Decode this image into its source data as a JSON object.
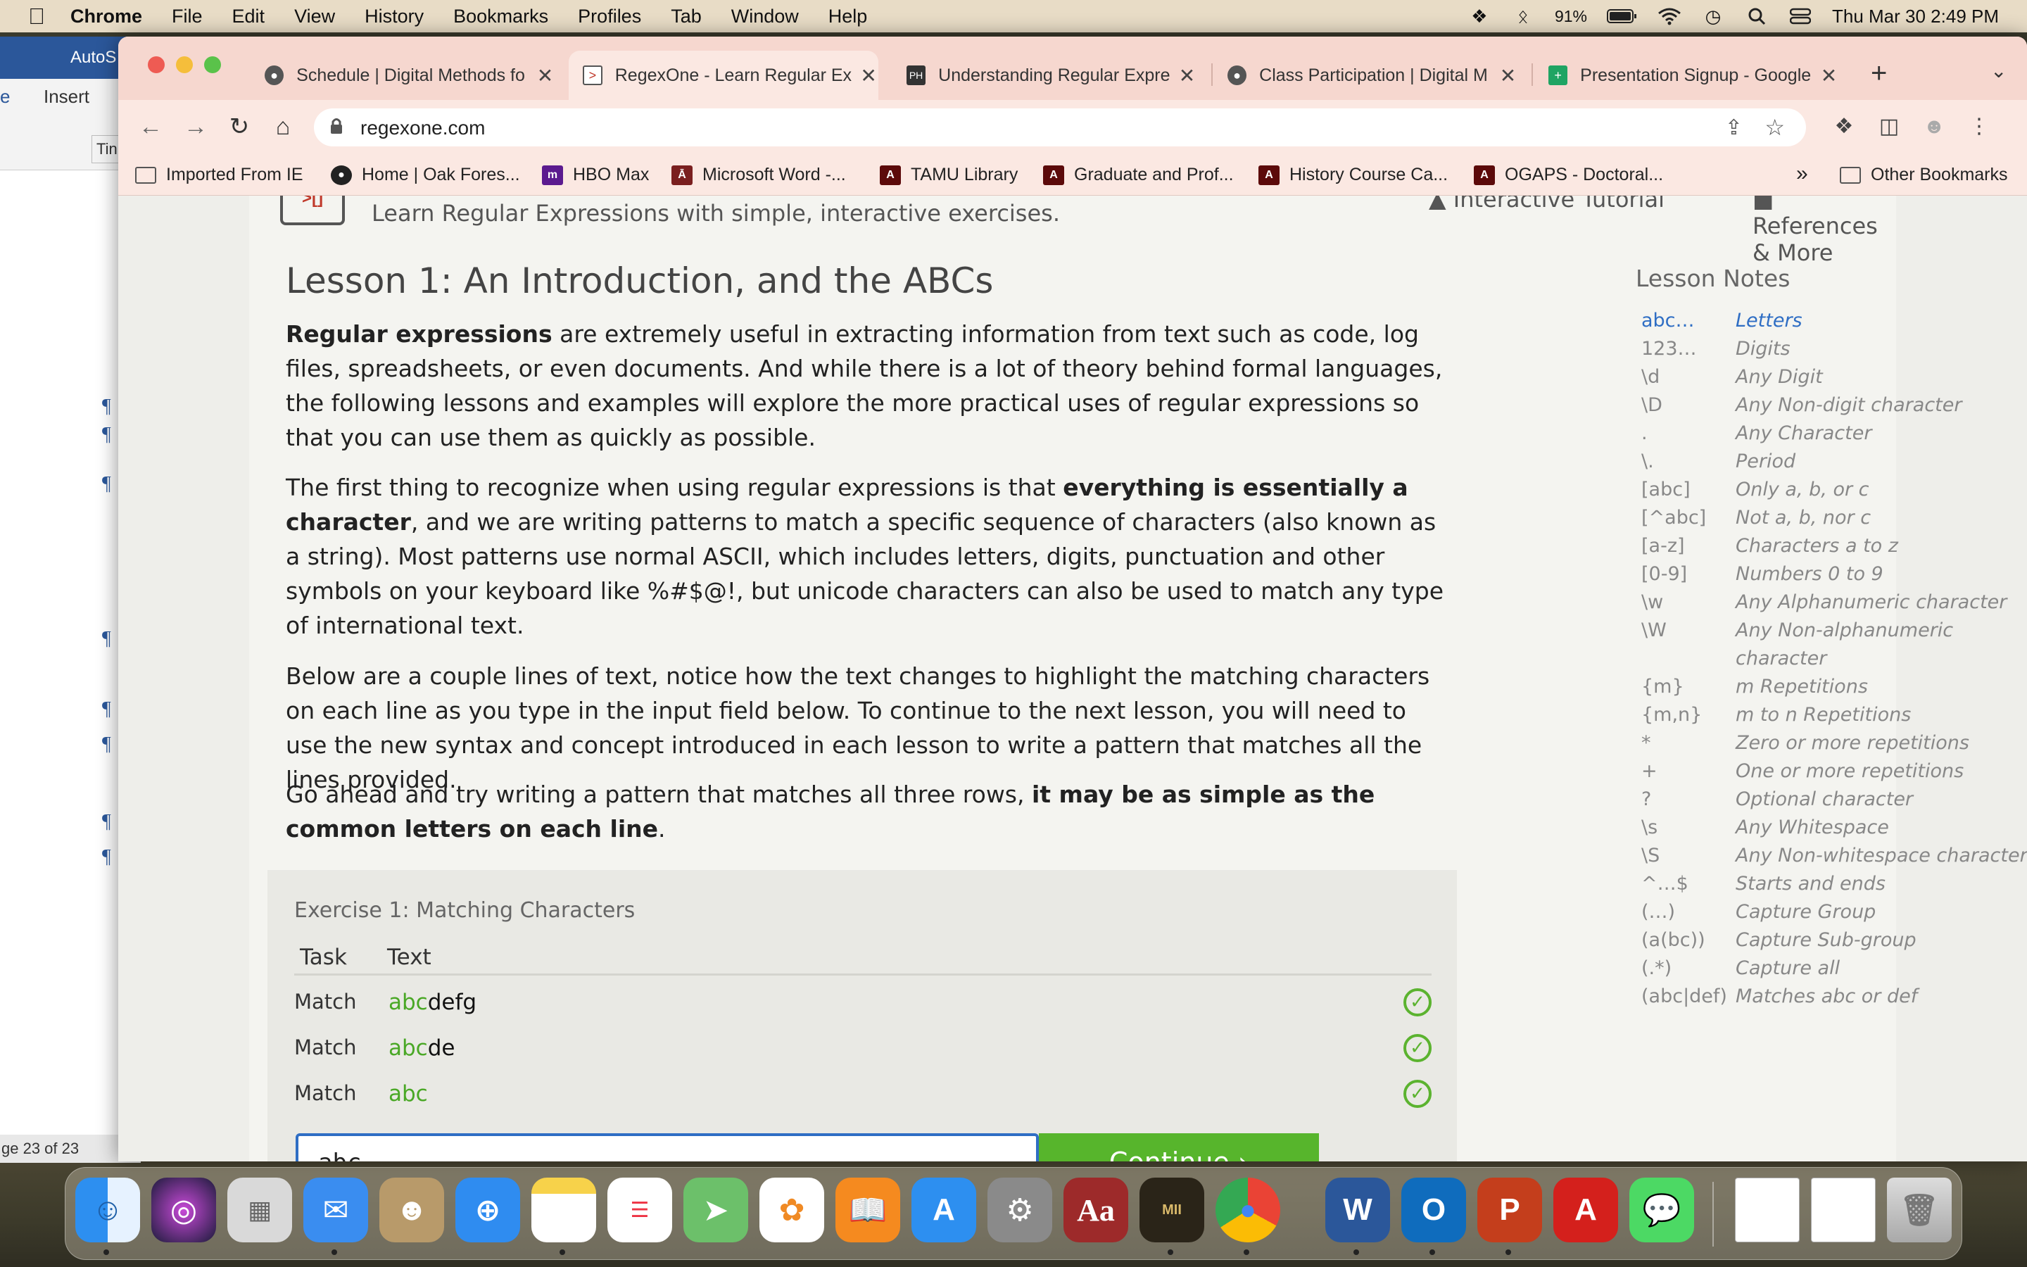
{
  "menubar": {
    "app_name": "Chrome",
    "menus": [
      "File",
      "Edit",
      "View",
      "History",
      "Bookmarks",
      "Profiles",
      "Tab",
      "Window",
      "Help"
    ],
    "battery": "91%",
    "datetime": "Thu Mar 30  2:49 PM"
  },
  "word": {
    "title": "AutoS",
    "tabs": [
      "e",
      "Insert"
    ],
    "font_box": "Tin",
    "status": "ge 23 of 23"
  },
  "tabs": [
    {
      "title": "Schedule | Digital Methods fo",
      "favicon": "globe-icon"
    },
    {
      "title": "RegexOne - Learn Regular Ex",
      "favicon": "regexone-icon"
    },
    {
      "title": "Understanding Regular Expre",
      "favicon": "ph-icon"
    },
    {
      "title": "Class Participation | Digital M",
      "favicon": "globe-icon"
    },
    {
      "title": "Presentation Signup - Google",
      "favicon": "sheets-icon"
    }
  ],
  "address": {
    "url": "regexone.com"
  },
  "bookmarks": [
    {
      "label": "Imported From IE",
      "icon": "folder-icon"
    },
    {
      "label": "Home | Oak Fores...",
      "icon": "globe-icon"
    },
    {
      "label": "HBO Max",
      "icon": "hbo-icon"
    },
    {
      "label": "Microsoft Word -...",
      "icon": "tamu-icon"
    },
    {
      "label": "TAMU Library",
      "icon": "tamu-icon"
    },
    {
      "label": "Graduate and Prof...",
      "icon": "tamu-icon"
    },
    {
      "label": "History Course Ca...",
      "icon": "tamu-icon"
    },
    {
      "label": "OGAPS - Doctoral...",
      "icon": "tamu-icon"
    }
  ],
  "bookmarks_more": "»",
  "other_bookmarks": "Other Bookmarks",
  "site": {
    "tagline": "Learn Regular Expressions with simple, interactive exercises.",
    "nav_tutorial": "Interactive Tutorial",
    "nav_references": "References & More"
  },
  "lesson": {
    "title": "Lesson 1: An Introduction, and the ABCs",
    "p1_bold": "Regular expressions",
    "p1_rest": " are extremely useful in extracting information from text such as code, log files, spreadsheets, or even documents. And while there is a lot of theory behind formal languages, the following lessons and examples will explore the more practical uses of regular expressions so that you can use them as quickly as possible.",
    "p2_start": "The first thing to recognize when using regular expressions is that ",
    "p2_bold": "everything is essentially a character",
    "p2_rest": ", and we are writing patterns to match a specific sequence of characters (also known as a string). Most patterns use normal ASCII, which includes letters, digits, punctuation and other symbols on your keyboard like %#$@!, but unicode characters can also be used to match any type of international text.",
    "p3": "Below are a couple lines of text, notice how the text changes to highlight the matching characters on each line as you type in the input field below. To continue to the next lesson, you will need to use the new syntax and concept introduced in each lesson to write a pattern that matches all the lines provided.",
    "p4_start": "Go ahead and try writing a pattern that matches all three rows, ",
    "p4_bold": "it may be as simple as the common letters on each line",
    "p4_end": "."
  },
  "exercise": {
    "title": "Exercise 1: Matching Characters",
    "col_task": "Task",
    "col_text": "Text",
    "rows": [
      {
        "task": "Match",
        "match": "abc",
        "rest": "defg"
      },
      {
        "task": "Match",
        "match": "abc",
        "rest": "de"
      },
      {
        "task": "Match",
        "match": "abc",
        "rest": ""
      }
    ],
    "input_value": "abc",
    "continue_label": "Continue ›"
  },
  "notes": {
    "title": "Lesson Notes",
    "items": [
      {
        "sym": "abc…",
        "desc": "Letters"
      },
      {
        "sym": "123…",
        "desc": "Digits"
      },
      {
        "sym": "\\d",
        "desc": "Any Digit"
      },
      {
        "sym": "\\D",
        "desc": "Any Non-digit character"
      },
      {
        "sym": ".",
        "desc": "Any Character"
      },
      {
        "sym": "\\.",
        "desc": "Period"
      },
      {
        "sym": "[abc]",
        "desc": "Only a, b, or c"
      },
      {
        "sym": "[^abc]",
        "desc": "Not a, b, nor c"
      },
      {
        "sym": "[a-z]",
        "desc": "Characters a to z"
      },
      {
        "sym": "[0-9]",
        "desc": "Numbers 0 to 9"
      },
      {
        "sym": "\\w",
        "desc": "Any Alphanumeric character"
      },
      {
        "sym": "\\W",
        "desc": "Any Non-alphanumeric"
      },
      {
        "sym": "",
        "desc": "character"
      },
      {
        "sym": "{m}",
        "desc": "m Repetitions"
      },
      {
        "sym": "{m,n}",
        "desc": "m to n Repetitions"
      },
      {
        "sym": "*",
        "desc": "Zero or more repetitions"
      },
      {
        "sym": "+",
        "desc": "One or more repetitions"
      },
      {
        "sym": "?",
        "desc": "Optional character"
      },
      {
        "sym": "\\s",
        "desc": "Any Whitespace"
      },
      {
        "sym": "\\S",
        "desc": "Any Non-whitespace character"
      },
      {
        "sym": "^…$",
        "desc": "Starts and ends"
      },
      {
        "sym": "(…)",
        "desc": "Capture Group"
      },
      {
        "sym": "(a(bc))",
        "desc": "Capture Sub-group"
      },
      {
        "sym": "(.*)",
        "desc": "Capture all"
      },
      {
        "sym": "(abc|def)",
        "desc": "Matches abc or def"
      }
    ]
  },
  "dock": [
    "Finder",
    "Siri",
    "Launchpad",
    "Mail",
    "Contacts",
    "Safari",
    "Notes",
    "Reminders",
    "Maps",
    "Photos",
    "Books",
    "App Store",
    "System Preferences",
    "Dictionary",
    "Medieval II",
    "Chrome",
    "Word",
    "Outlook",
    "PowerPoint",
    "Acrobat",
    "Messages",
    "Document 1",
    "Document 2",
    "Trash"
  ],
  "colors": {
    "accent": "#2f6ec4",
    "match_green": "#4aa826",
    "continue_green": "#57b52c",
    "tab_strip": "#f6d7cf"
  }
}
